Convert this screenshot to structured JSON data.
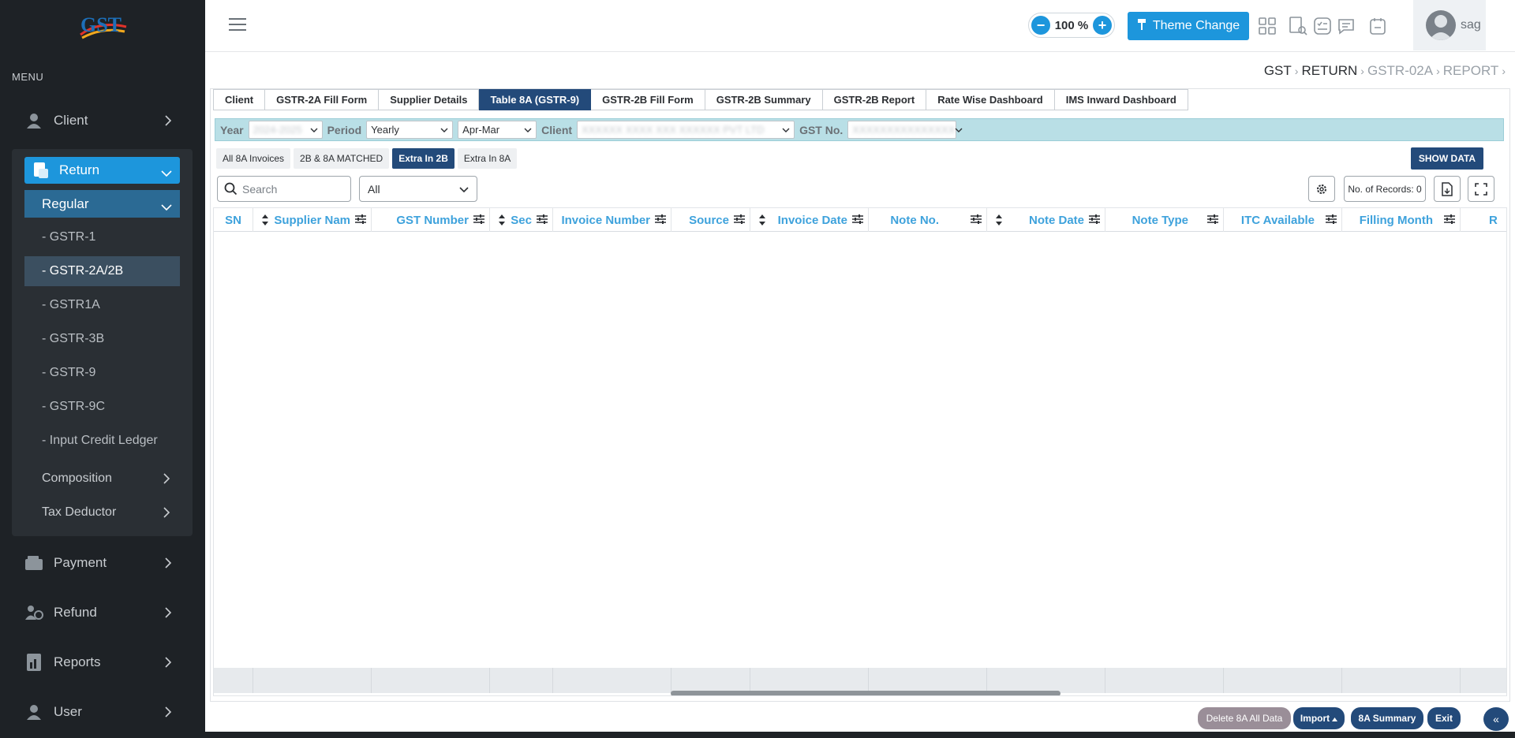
{
  "app": {
    "logo_text": "GST"
  },
  "sidebar": {
    "menu_caption": "MENU",
    "client": "Client",
    "return": "Return",
    "regular": "Regular",
    "regular_items": [
      "- GSTR-1",
      "- GSTR-2A/2B",
      "- GSTR1A",
      "- GSTR-3B",
      "- GSTR-9",
      "- GSTR-9C",
      "- Input Credit Ledger"
    ],
    "active_index": 1,
    "composition": "Composition",
    "tax_deductor": "Tax Deductor",
    "payment": "Payment",
    "refund": "Refund",
    "reports": "Reports",
    "user": "User"
  },
  "topbar": {
    "zoom_minus": "−",
    "zoom_value": "100 %",
    "zoom_plus": "+",
    "theme_button": "Theme Change",
    "username": "sag"
  },
  "breadcrumb": {
    "gst": "GST",
    "ret": "RETURN",
    "gstr": "GSTR-02A",
    "report": "REPORT"
  },
  "tabs": [
    "Client",
    "GSTR-2A Fill Form",
    "Supplier Details",
    "Table 8A (GSTR-9)",
    "GSTR-2B Fill Form",
    "GSTR-2B Summary",
    "GSTR-2B Report",
    "Rate Wise Dashboard",
    "IMS Inward Dashboard"
  ],
  "active_tab": "Table 8A (GSTR-9)",
  "filters": {
    "year_label": "Year",
    "year_value": "2024-2025",
    "period_label": "Period",
    "period_value": "Yearly",
    "range_value": "Apr-Mar",
    "client_label": "Client",
    "client_value": "XXXXXX XXXX XXX XXXXXX PVT LTD",
    "gst_label": "GST No.",
    "gst_value": "XXXXXXXXXXXXXXX"
  },
  "subtabs": [
    "All 8A Invoices",
    "2B & 8A MATCHED",
    "Extra In 2B",
    "Extra In 8A"
  ],
  "active_subtab": "Extra In 2B",
  "show_data": "SHOW DATA",
  "search": {
    "placeholder": "Search"
  },
  "all_select": "All",
  "records": "No. of Records: 0",
  "columns": [
    "SN",
    "Supplier Nam",
    "GST Number",
    "Sec",
    "Invoice Number",
    "Source",
    "Invoice Date",
    "Note No.",
    "Note Date",
    "Note Type",
    "ITC Available",
    "Filling Month",
    "R"
  ],
  "bottom_buttons": {
    "delete": "Delete 8A All Data",
    "import": "Import",
    "summary": "8A Summary",
    "exit": "Exit",
    "collapse": "«"
  },
  "colors": {
    "accent": "#1d96dc",
    "navy": "#234a7a",
    "sidebar": "#1e2226",
    "filter_bar": "#b9dfe6"
  }
}
